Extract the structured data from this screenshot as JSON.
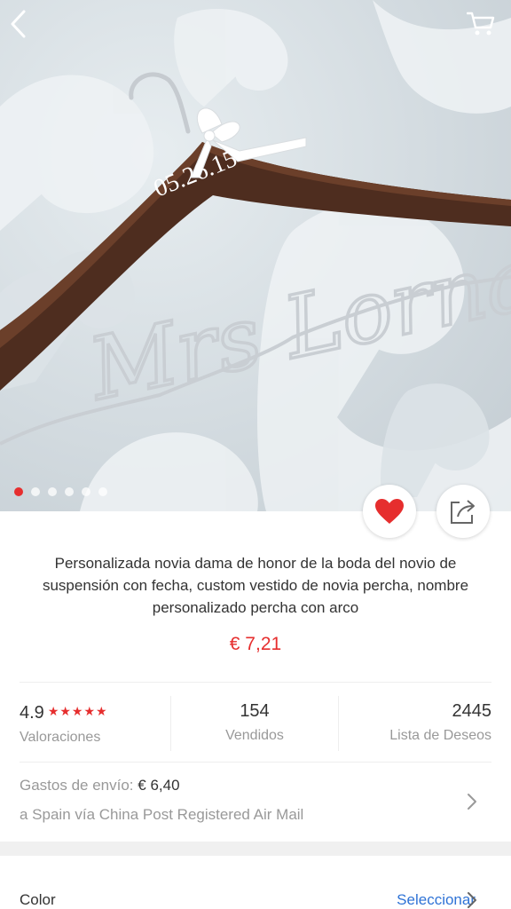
{
  "nav": {
    "back_icon": "chevron-left-icon",
    "cart_icon": "cart-icon"
  },
  "hero": {
    "engraving": "05.26.15",
    "wire_name": "Mrs Lorna",
    "image_count": 6,
    "active_index": 0
  },
  "actions": {
    "favorite_icon": "heart-icon",
    "share_icon": "share-icon",
    "accent": "#e62e2e"
  },
  "product": {
    "title": "Personalizada novia dama de honor de la boda del novio de suspensión con fecha, custom vestido de novia percha, nombre personalizado percha con arco",
    "price": "€ 7,21"
  },
  "stats": {
    "rating_value": "4.9",
    "rating_stars": "★★★★★",
    "rating_label": "Valoraciones",
    "sold_value": "154",
    "sold_label": "Vendidos",
    "wishlist_value": "2445",
    "wishlist_label": "Lista de Deseos"
  },
  "shipping": {
    "label": "Gastos de envío:",
    "cost": "€ 6,40",
    "destination": "a Spain vía China Post Registered Air Mail"
  },
  "color_row": {
    "label": "Color",
    "action": "Seleccionar"
  }
}
